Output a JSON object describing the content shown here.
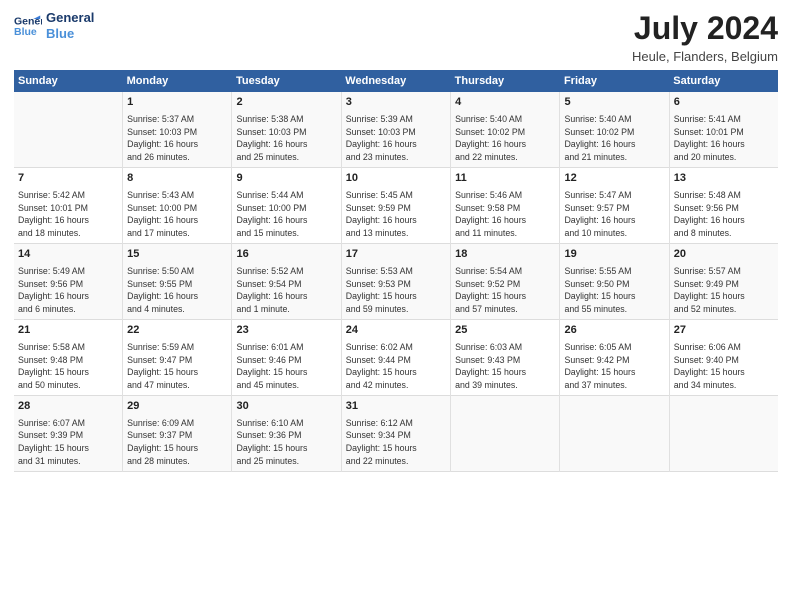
{
  "header": {
    "logo_line1": "General",
    "logo_line2": "Blue",
    "title": "July 2024",
    "subtitle": "Heule, Flanders, Belgium"
  },
  "days_of_week": [
    "Sunday",
    "Monday",
    "Tuesday",
    "Wednesday",
    "Thursday",
    "Friday",
    "Saturday"
  ],
  "weeks": [
    [
      {
        "day": "",
        "info": ""
      },
      {
        "day": "1",
        "info": "Sunrise: 5:37 AM\nSunset: 10:03 PM\nDaylight: 16 hours\nand 26 minutes."
      },
      {
        "day": "2",
        "info": "Sunrise: 5:38 AM\nSunset: 10:03 PM\nDaylight: 16 hours\nand 25 minutes."
      },
      {
        "day": "3",
        "info": "Sunrise: 5:39 AM\nSunset: 10:03 PM\nDaylight: 16 hours\nand 23 minutes."
      },
      {
        "day": "4",
        "info": "Sunrise: 5:40 AM\nSunset: 10:02 PM\nDaylight: 16 hours\nand 22 minutes."
      },
      {
        "day": "5",
        "info": "Sunrise: 5:40 AM\nSunset: 10:02 PM\nDaylight: 16 hours\nand 21 minutes."
      },
      {
        "day": "6",
        "info": "Sunrise: 5:41 AM\nSunset: 10:01 PM\nDaylight: 16 hours\nand 20 minutes."
      }
    ],
    [
      {
        "day": "7",
        "info": "Sunrise: 5:42 AM\nSunset: 10:01 PM\nDaylight: 16 hours\nand 18 minutes."
      },
      {
        "day": "8",
        "info": "Sunrise: 5:43 AM\nSunset: 10:00 PM\nDaylight: 16 hours\nand 17 minutes."
      },
      {
        "day": "9",
        "info": "Sunrise: 5:44 AM\nSunset: 10:00 PM\nDaylight: 16 hours\nand 15 minutes."
      },
      {
        "day": "10",
        "info": "Sunrise: 5:45 AM\nSunset: 9:59 PM\nDaylight: 16 hours\nand 13 minutes."
      },
      {
        "day": "11",
        "info": "Sunrise: 5:46 AM\nSunset: 9:58 PM\nDaylight: 16 hours\nand 11 minutes."
      },
      {
        "day": "12",
        "info": "Sunrise: 5:47 AM\nSunset: 9:57 PM\nDaylight: 16 hours\nand 10 minutes."
      },
      {
        "day": "13",
        "info": "Sunrise: 5:48 AM\nSunset: 9:56 PM\nDaylight: 16 hours\nand 8 minutes."
      }
    ],
    [
      {
        "day": "14",
        "info": "Sunrise: 5:49 AM\nSunset: 9:56 PM\nDaylight: 16 hours\nand 6 minutes."
      },
      {
        "day": "15",
        "info": "Sunrise: 5:50 AM\nSunset: 9:55 PM\nDaylight: 16 hours\nand 4 minutes."
      },
      {
        "day": "16",
        "info": "Sunrise: 5:52 AM\nSunset: 9:54 PM\nDaylight: 16 hours\nand 1 minute."
      },
      {
        "day": "17",
        "info": "Sunrise: 5:53 AM\nSunset: 9:53 PM\nDaylight: 15 hours\nand 59 minutes."
      },
      {
        "day": "18",
        "info": "Sunrise: 5:54 AM\nSunset: 9:52 PM\nDaylight: 15 hours\nand 57 minutes."
      },
      {
        "day": "19",
        "info": "Sunrise: 5:55 AM\nSunset: 9:50 PM\nDaylight: 15 hours\nand 55 minutes."
      },
      {
        "day": "20",
        "info": "Sunrise: 5:57 AM\nSunset: 9:49 PM\nDaylight: 15 hours\nand 52 minutes."
      }
    ],
    [
      {
        "day": "21",
        "info": "Sunrise: 5:58 AM\nSunset: 9:48 PM\nDaylight: 15 hours\nand 50 minutes."
      },
      {
        "day": "22",
        "info": "Sunrise: 5:59 AM\nSunset: 9:47 PM\nDaylight: 15 hours\nand 47 minutes."
      },
      {
        "day": "23",
        "info": "Sunrise: 6:01 AM\nSunset: 9:46 PM\nDaylight: 15 hours\nand 45 minutes."
      },
      {
        "day": "24",
        "info": "Sunrise: 6:02 AM\nSunset: 9:44 PM\nDaylight: 15 hours\nand 42 minutes."
      },
      {
        "day": "25",
        "info": "Sunrise: 6:03 AM\nSunset: 9:43 PM\nDaylight: 15 hours\nand 39 minutes."
      },
      {
        "day": "26",
        "info": "Sunrise: 6:05 AM\nSunset: 9:42 PM\nDaylight: 15 hours\nand 37 minutes."
      },
      {
        "day": "27",
        "info": "Sunrise: 6:06 AM\nSunset: 9:40 PM\nDaylight: 15 hours\nand 34 minutes."
      }
    ],
    [
      {
        "day": "28",
        "info": "Sunrise: 6:07 AM\nSunset: 9:39 PM\nDaylight: 15 hours\nand 31 minutes."
      },
      {
        "day": "29",
        "info": "Sunrise: 6:09 AM\nSunset: 9:37 PM\nDaylight: 15 hours\nand 28 minutes."
      },
      {
        "day": "30",
        "info": "Sunrise: 6:10 AM\nSunset: 9:36 PM\nDaylight: 15 hours\nand 25 minutes."
      },
      {
        "day": "31",
        "info": "Sunrise: 6:12 AM\nSunset: 9:34 PM\nDaylight: 15 hours\nand 22 minutes."
      },
      {
        "day": "",
        "info": ""
      },
      {
        "day": "",
        "info": ""
      },
      {
        "day": "",
        "info": ""
      }
    ]
  ]
}
